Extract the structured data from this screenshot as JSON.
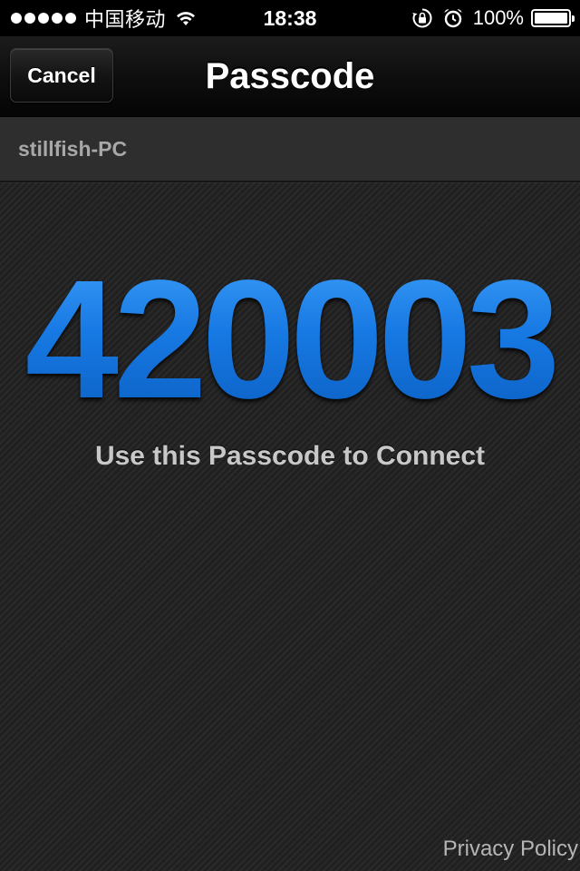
{
  "status_bar": {
    "carrier": "中国移动",
    "time": "18:38",
    "battery_percent": "100%",
    "battery_level": 1.0,
    "signal_bars": 5,
    "icons": [
      "signal-dots-icon",
      "wifi-icon",
      "orientation-lock-icon",
      "alarm-icon",
      "battery-icon"
    ]
  },
  "nav": {
    "cancel_label": "Cancel",
    "title": "Passcode"
  },
  "device": {
    "name": "stillfish-PC"
  },
  "passcode": {
    "value": "420003",
    "hint": "Use this Passcode to Connect"
  },
  "footer": {
    "privacy_label": "Privacy Policy"
  },
  "colors": {
    "passcode_blue": "#1b7ee8",
    "background": "#222222",
    "nav_background": "#0d0d0d"
  }
}
